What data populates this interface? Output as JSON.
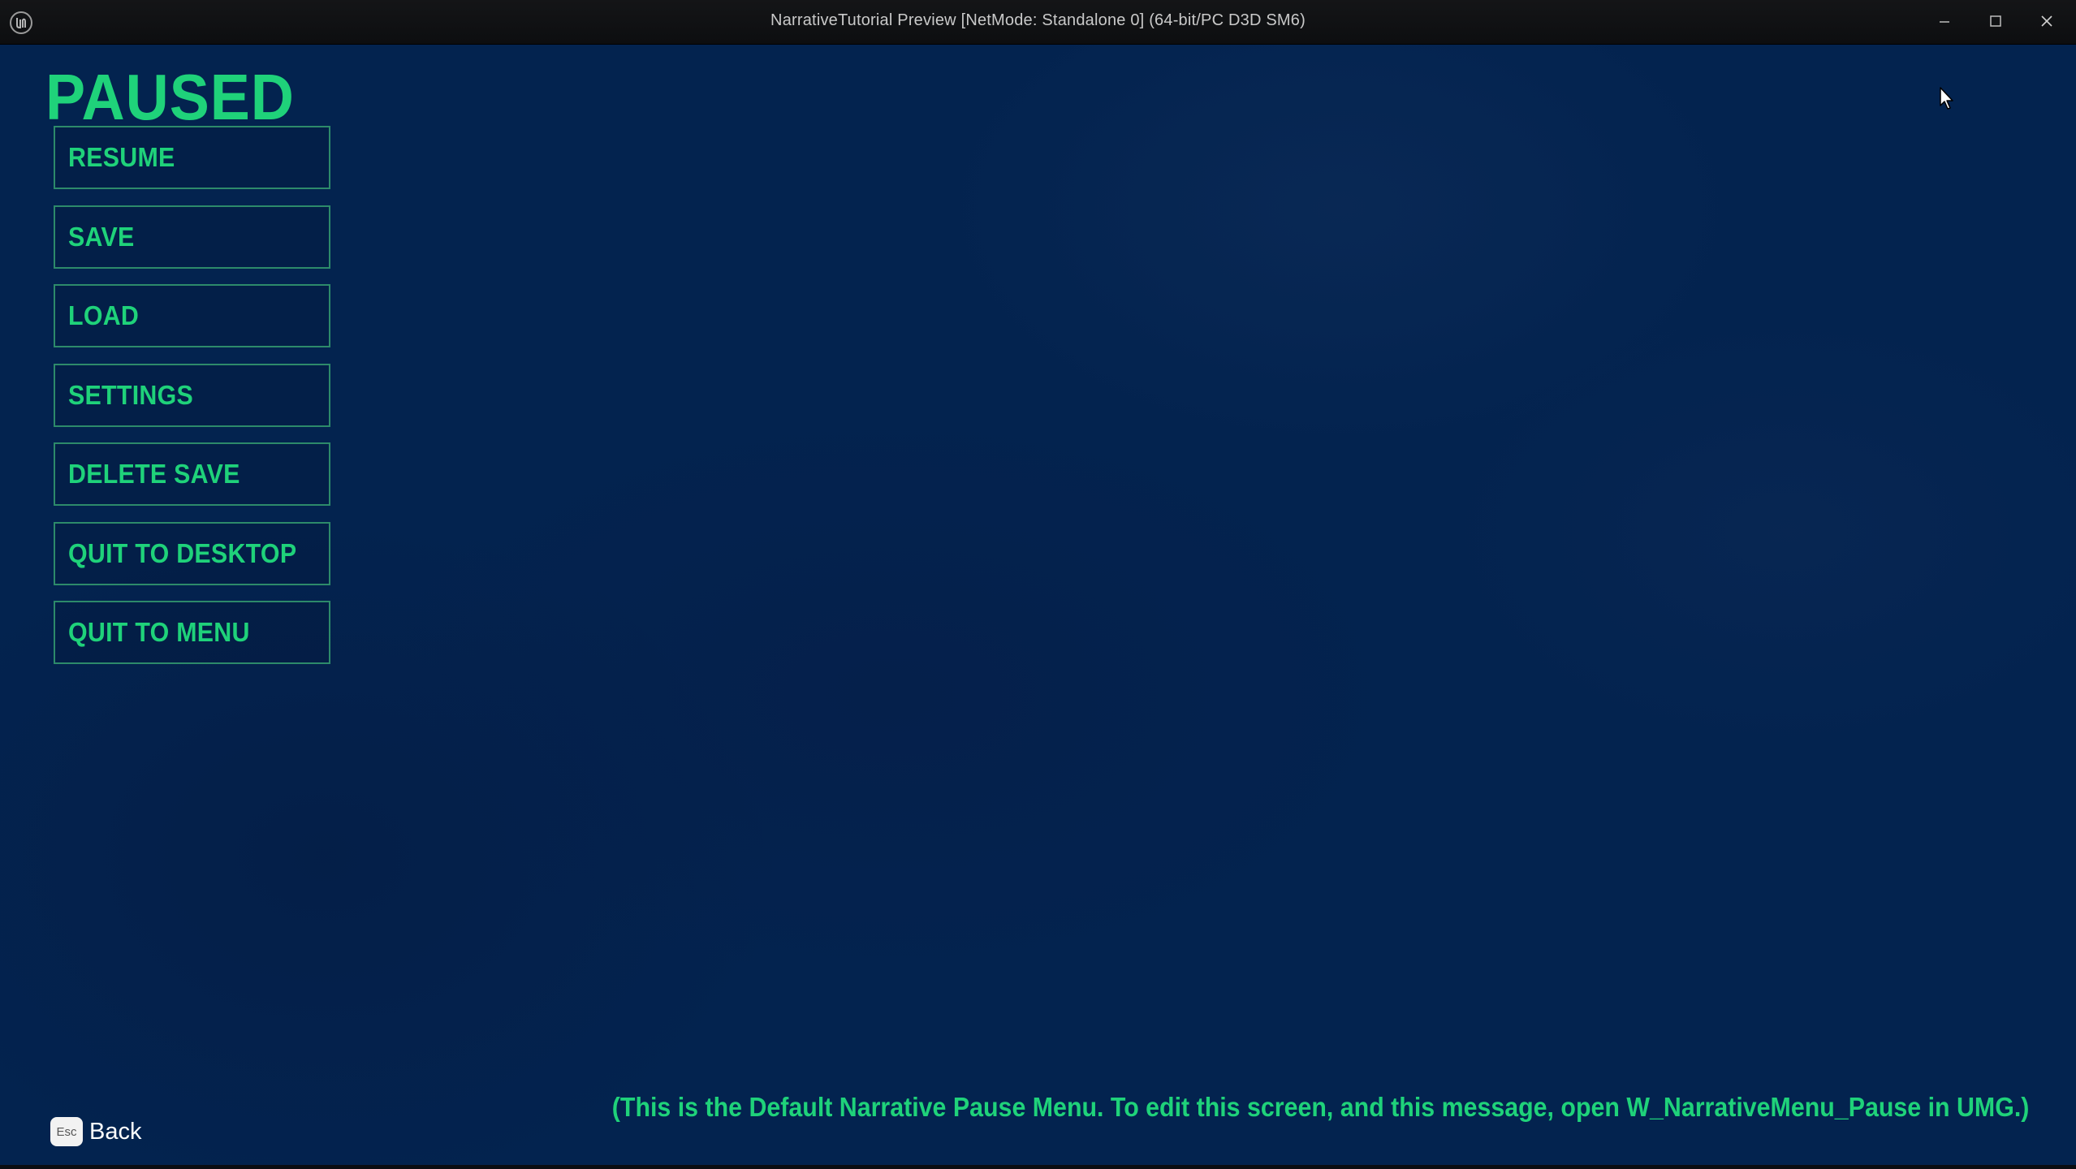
{
  "window": {
    "title": "NarrativeTutorial Preview [NetMode: Standalone 0]  (64-bit/PC D3D SM6)",
    "app_icon": "unreal-engine-logo",
    "controls": {
      "minimize_icon": "minimize-icon",
      "maximize_icon": "maximize-icon",
      "close_icon": "close-icon"
    }
  },
  "pause_menu": {
    "heading": "PAUSED",
    "buttons": [
      {
        "label": "RESUME"
      },
      {
        "label": "SAVE"
      },
      {
        "label": "LOAD"
      },
      {
        "label": "SETTINGS"
      },
      {
        "label": "DELETE SAVE"
      },
      {
        "label": "QUIT TO DESKTOP"
      },
      {
        "label": "QUIT TO MENU"
      }
    ]
  },
  "back_hint": {
    "key": "Esc",
    "label": "Back"
  },
  "footer_note": "(This is the Default Narrative Pause Menu. To edit this screen, and this message, open W_NarrativeMenu_Pause in UMG.)",
  "colors": {
    "accent_green": "#1fd27a",
    "button_border": "#2d8a6a",
    "background_blue": "#03234f",
    "titlebar": "#111214"
  }
}
